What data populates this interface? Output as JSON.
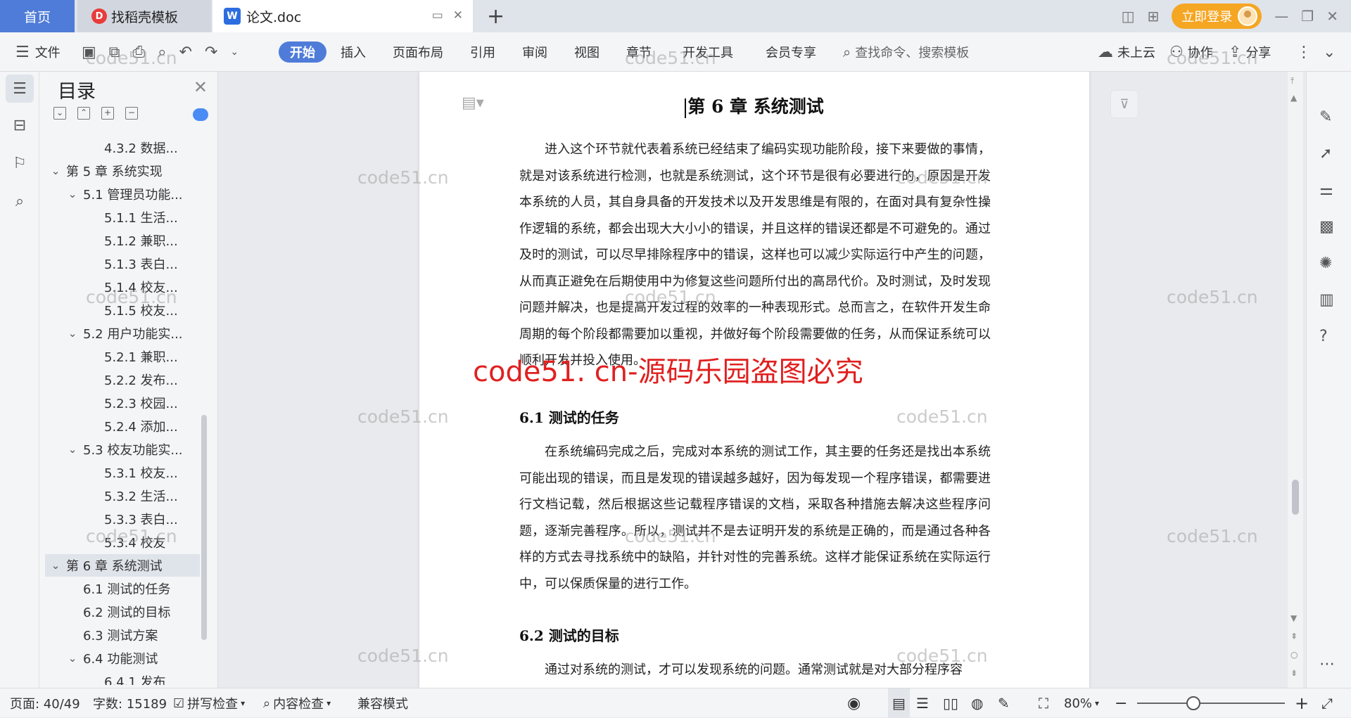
{
  "tabs": {
    "home": "首页",
    "templates": "找稻壳模板",
    "document": "论文.doc",
    "new_tab": "+"
  },
  "window": {
    "login": "立即登录"
  },
  "toolbar": {
    "file": "文件",
    "ribbon": [
      "开始",
      "插入",
      "页面布局",
      "引用",
      "审阅",
      "视图",
      "章节",
      "开发工具",
      "会员专享"
    ],
    "search_placeholder": "查找命令、搜索模板",
    "cloud": "未上云",
    "collab": "协作",
    "share": "分享"
  },
  "toc": {
    "title": "目录",
    "items": [
      {
        "level": 3,
        "label": "4.3.2 数据...",
        "chevron": ""
      },
      {
        "level": 1,
        "label": "第 5 章  系统实现",
        "chevron": "v"
      },
      {
        "level": 2,
        "label": "5.1 管理员功能...",
        "chevron": "v"
      },
      {
        "level": 3,
        "label": "5.1.1 生活...",
        "chevron": ""
      },
      {
        "level": 3,
        "label": "5.1.2 兼职...",
        "chevron": ""
      },
      {
        "level": 3,
        "label": "5.1.3 表白...",
        "chevron": ""
      },
      {
        "level": 3,
        "label": "5.1.4 校友...",
        "chevron": ""
      },
      {
        "level": 3,
        "label": "5.1.5 校友...",
        "chevron": ""
      },
      {
        "level": 2,
        "label": "5.2 用户功能实...",
        "chevron": "v"
      },
      {
        "level": 3,
        "label": "5.2.1 兼职...",
        "chevron": ""
      },
      {
        "level": 3,
        "label": "5.2.2 发布...",
        "chevron": ""
      },
      {
        "level": 3,
        "label": "5.2.3 校园...",
        "chevron": ""
      },
      {
        "level": 3,
        "label": "5.2.4 添加...",
        "chevron": ""
      },
      {
        "level": 2,
        "label": "5.3 校友功能实...",
        "chevron": "v"
      },
      {
        "level": 3,
        "label": "5.3.1 校友...",
        "chevron": ""
      },
      {
        "level": 3,
        "label": "5.3.2 生活...",
        "chevron": ""
      },
      {
        "level": 3,
        "label": "5.3.3 表白...",
        "chevron": ""
      },
      {
        "level": 3,
        "label": "5.3.4 校友",
        "chevron": ""
      },
      {
        "level": 1,
        "label": "第 6 章  系统测试",
        "chevron": "v",
        "selected": true
      },
      {
        "level": 2,
        "label": "6.1 测试的任务",
        "chevron": ""
      },
      {
        "level": 2,
        "label": "6.2 测试的目标",
        "chevron": ""
      },
      {
        "level": 2,
        "label": "6.3 测试方案",
        "chevron": ""
      },
      {
        "level": 2,
        "label": "6.4 功能测试",
        "chevron": "v"
      },
      {
        "level": 3,
        "label": "6.4.1 发布",
        "chevron": ""
      }
    ]
  },
  "document": {
    "chapter_title": "第 6 章  系统测试",
    "intro": "进入这个环节就代表着系统已经结束了编码实现功能阶段，接下来要做的事情，就是对该系统进行检测，也就是系统测试，这个环节是很有必要进行的，原因是开发本系统的人员，其自身具备的开发技术以及开发思维是有限的，在面对具有复杂性操作逻辑的系统，都会出现大大小小的错误，并且这样的错误还都是不可避免的。通过及时的测试，可以尽早排除程序中的错误，这样也可以减少实际运行中产生的问题，从而真正避免在后期使用中为修复这些问题所付出的高昂代价。及时测试，及时发现问题并解决，也是提高开发过程的效率的一种表现形式。总而言之，在软件开发生命周期的每个阶段都需要加以重视，并做好每个阶段需要做的任务，从而保证系统可以顺利开发并投入使用。",
    "section1_title": "6.1  测试的任务",
    "section1_text": "在系统编码完成之后，完成对本系统的测试工作，其主要的任务还是找出本系统可能出现的错误，而且是发现的错误越多越好，因为每发现一个程序错误，都需要进行文档记载，然后根据这些记载程序错误的文档，采取各种措施去解决这些程序问题，逐渐完善程序。所以，测试并不是去证明开发的系统是正确的，而是通过各种各样的方式去寻找系统中的缺陷，并针对性的完善系统。这样才能保证系统在实际运行中，可以保质保量的进行工作。",
    "section2_title": "6.2  测试的目标",
    "section2_text": "通过对系统的测试，才可以发现系统的问题。通常测试就是对大部分程序容"
  },
  "watermark": {
    "text": "code51.cn",
    "red": "code51. cn-源码乐园盗图必究"
  },
  "status": {
    "page": "页面: 40/49",
    "words": "字数: 15189",
    "spellcheck": "拼写检查",
    "content_check": "内容检查",
    "compat": "兼容模式",
    "zoom": "80%"
  },
  "colors": {
    "accent": "#4f7cd8",
    "login": "#f5a623",
    "watermark_red": "#e02020"
  }
}
